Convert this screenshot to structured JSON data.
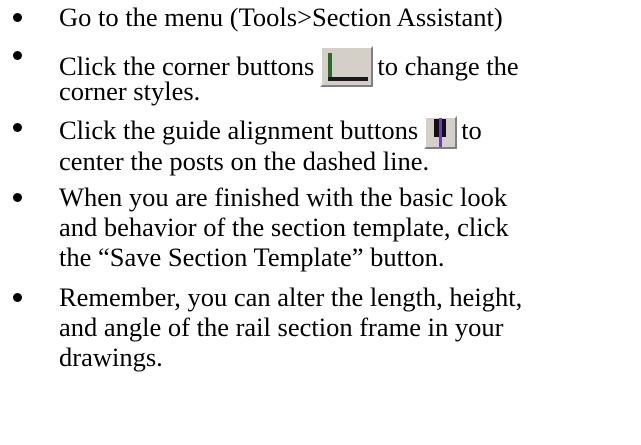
{
  "instructions": {
    "item1": {
      "text": "Go to the menu (Tools>Section Assistant)"
    },
    "item2": {
      "before_icon": "Click the corner buttons",
      "after_icon": "to change the",
      "line2": "corner styles.",
      "icon": "corner-button-icon"
    },
    "item3": {
      "before_icon": "Click the guide alignment buttons",
      "after_icon": "to",
      "line2": "center the posts on the dashed line.",
      "icon": "guide-alignment-button-icon"
    },
    "item4": {
      "line1": "When you are finished with the basic look",
      "line2": "and behavior of the section template, click",
      "line3": "the “Save Section Template” button."
    },
    "item5": {
      "line1": "Remember, you can alter the length, height,",
      "line2": "and angle of the rail section frame in your",
      "line3": "drawings."
    }
  },
  "colors": {
    "text": "#000000",
    "button_face": "#d4d0c8",
    "corner_vertical_bar": "#2a6a2a",
    "guide_line": "#6a3fb0"
  }
}
